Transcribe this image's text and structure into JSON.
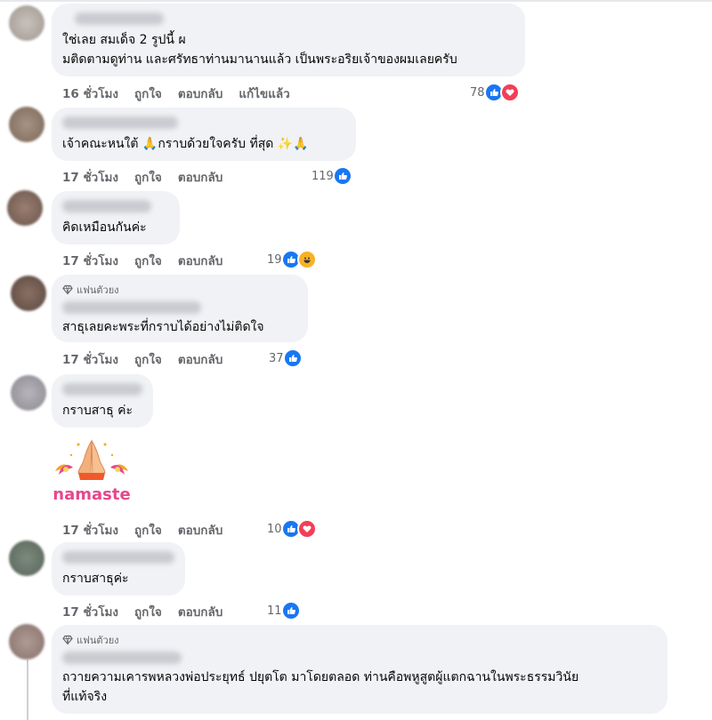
{
  "comments": [
    {
      "text": "ใช่เลย สมเด็จ 2 รูปนี้ ผ\nมติดตามดูท่าน และศรัทธาท่านมานานแล้ว เป็นพระอริยเจ้าของผมเลยครับ",
      "time": "16 ชั่วโมง",
      "like": "ถูกใจ",
      "reply": "ตอบกลับ",
      "edited": "แก้ไขแล้ว",
      "count": "78",
      "reactions": [
        "like-icon",
        "love-icon"
      ]
    },
    {
      "text": "เจ้าคณะหนใต้ 🙏กราบด้วยใจครับ ที่สุด ✨🙏",
      "time": "17 ชั่วโมง",
      "like": "ถูกใจ",
      "reply": "ตอบกลับ",
      "count": "119",
      "reactions": [
        "like-icon"
      ]
    },
    {
      "text": "คิดเหมือนกันค่ะ",
      "time": "17 ชั่วโมง",
      "like": "ถูกใจ",
      "reply": "ตอบกลับ",
      "count": "19",
      "reactions": [
        "like-icon",
        "haha-icon"
      ]
    },
    {
      "badge": "แฟนตัวยง",
      "text": "สาธุเลยคะพระที่กราบได้อย่างไม่ติดใจ",
      "time": "17 ชั่วโมง",
      "like": "ถูกใจ",
      "reply": "ตอบกลับ",
      "count": "37",
      "reactions": [
        "like-icon"
      ]
    },
    {
      "text": "กราบสาธุ ค่ะ",
      "sticker": "namaste",
      "time": "17 ชั่วโมง",
      "like": "ถูกใจ",
      "reply": "ตอบกลับ",
      "count": "10",
      "reactions": [
        "like-icon",
        "love-icon"
      ]
    },
    {
      "text": "กราบสาธุค่ะ",
      "time": "17 ชั่วโมง",
      "like": "ถูกใจ",
      "reply": "ตอบกลับ",
      "count": "11",
      "reactions": [
        "like-icon"
      ]
    },
    {
      "badge": "แฟนตัวยง",
      "text": "ถวายความเคารพหลวงพ่อประยุทธ์ ปยุตโต มาโดยตลอด ท่านคือพหูสูตผู้แตกฉานในพระธรรมวินัย\nที่แท้จริง"
    }
  ],
  "colors": {
    "like": "#1877f2",
    "love": "#f33e58",
    "haha": "#f7b125",
    "bubble": "#f0f2f5",
    "meta": "#65676b"
  }
}
